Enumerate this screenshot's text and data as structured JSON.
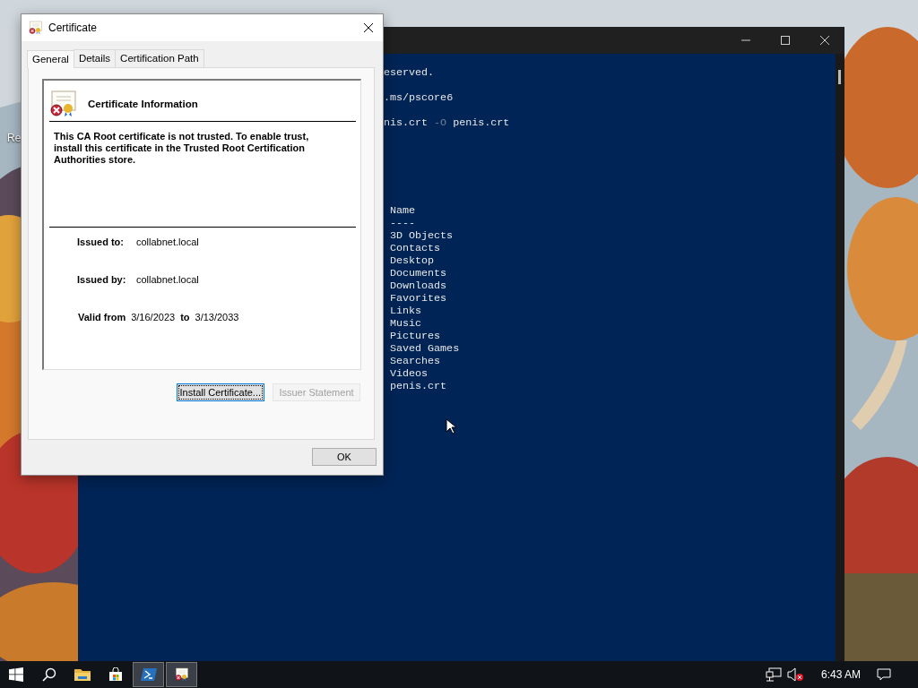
{
  "desktop": {
    "icon_labels": [
      "Re"
    ]
  },
  "terminal": {
    "lines": [
      {
        "segments": [
          {
            "text": "eserved.",
            "kind": "output"
          }
        ]
      },
      {
        "segments": [
          {
            "text": ".ms/pscore6",
            "kind": "output"
          }
        ]
      },
      {
        "segments": [
          {
            "text": "nis.crt",
            "kind": "output"
          },
          {
            "text": "-O",
            "kind": "parameter"
          },
          {
            "text": "penis.crt",
            "kind": "output"
          }
        ]
      }
    ],
    "listing": {
      "header": "Name",
      "rule": "----",
      "items": [
        "3D Objects",
        "Contacts",
        "Desktop",
        "Documents",
        "Downloads",
        "Favorites",
        "Links",
        "Music",
        "Pictures",
        "Saved Games",
        "Searches",
        "Videos",
        "penis.crt"
      ]
    }
  },
  "certificate_dialog": {
    "title": "Certificate",
    "tabs": [
      {
        "label": "General",
        "selected": true
      },
      {
        "label": "Details",
        "selected": false
      },
      {
        "label": "Certification Path",
        "selected": false
      }
    ],
    "heading": "Certificate Information",
    "message": "This CA Root certificate is not trusted. To enable trust, install this certificate in the Trusted Root Certification Authorities store.",
    "fields": [
      {
        "label": "Issued to:",
        "value": "collabnet.local"
      },
      {
        "label": "Issued by:",
        "value": "collabnet.local"
      }
    ],
    "validity": {
      "label": "Valid from",
      "from": "3/16/2023",
      "separator": "to",
      "until": "3/13/2033"
    },
    "buttons": [
      {
        "label": "Install Certificate...",
        "focused": true,
        "disabled": false
      },
      {
        "label": "Issuer Statement",
        "focused": false,
        "disabled": true
      }
    ],
    "ok_button": "OK"
  },
  "taskbar": {
    "items": [
      {
        "kind": "start",
        "selected": false
      },
      {
        "kind": "search",
        "selected": false
      },
      {
        "kind": "explorer",
        "selected": false
      },
      {
        "kind": "store",
        "selected": false
      },
      {
        "kind": "powershell",
        "selected": true
      },
      {
        "kind": "certificate",
        "selected": true
      }
    ],
    "tray": [
      {
        "kind": "network"
      },
      {
        "kind": "volume-muted"
      }
    ],
    "clock": "6:43 AM"
  }
}
